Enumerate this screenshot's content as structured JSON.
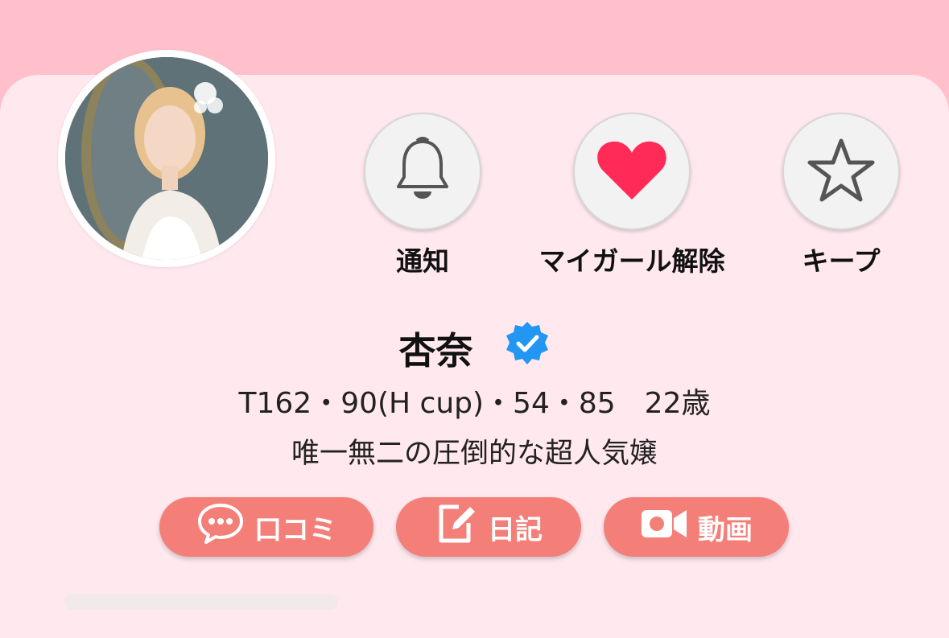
{
  "profile": {
    "name": "杏奈",
    "stats": "T162・90(H cup)・54・85　22歳",
    "catchphrase": "唯一無二の圧倒的な超人気嬢",
    "verified_icon": "verified-badge-icon"
  },
  "actions": [
    {
      "label": "通知",
      "icon": "bell-icon"
    },
    {
      "label": "マイガール解除",
      "icon": "heart-icon"
    },
    {
      "label": "キープ",
      "icon": "star-icon"
    }
  ],
  "links": [
    {
      "label": "口コミ",
      "icon": "chat-bubble-icon"
    },
    {
      "label": "日記",
      "icon": "edit-note-icon"
    },
    {
      "label": "動画",
      "icon": "video-camera-icon"
    }
  ],
  "colors": {
    "header_bg": "#ffc0cc",
    "card_bg": "#ffe8ee",
    "pill_bg": "#f47f79",
    "heart": "#ff2a55",
    "verified": "#2196f3"
  }
}
